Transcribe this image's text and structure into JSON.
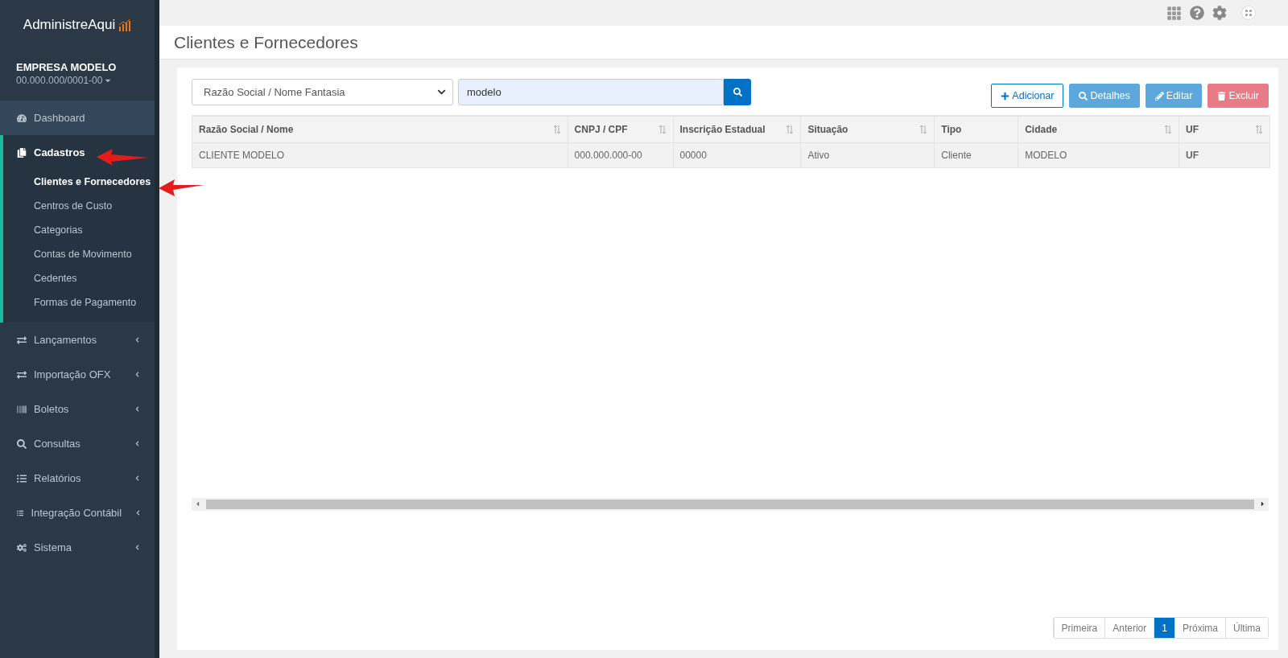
{
  "brand": {
    "name": "AdministreAqui"
  },
  "company": {
    "name": "EMPRESA MODELO",
    "document": "00.000.000/0001-00"
  },
  "sidebar": {
    "items": [
      {
        "label": "Dashboard",
        "selected": false,
        "has_submenu": false
      },
      {
        "label": "Cadastros",
        "selected": true,
        "has_submenu": false,
        "children": [
          {
            "label": "Clientes e Fornecedores",
            "selected": true
          },
          {
            "label": "Centros de Custo",
            "selected": false
          },
          {
            "label": "Categorias",
            "selected": false
          },
          {
            "label": "Contas de Movimento",
            "selected": false
          },
          {
            "label": "Cedentes",
            "selected": false
          },
          {
            "label": "Formas de Pagamento",
            "selected": false
          }
        ]
      },
      {
        "label": "Lançamentos",
        "selected": false,
        "has_submenu": true
      },
      {
        "label": "Importação OFX",
        "selected": false,
        "has_submenu": true
      },
      {
        "label": "Boletos",
        "selected": false,
        "has_submenu": true
      },
      {
        "label": "Consultas",
        "selected": false,
        "has_submenu": true
      },
      {
        "label": "Relatórios",
        "selected": false,
        "has_submenu": true
      },
      {
        "label": "Integração Contábil",
        "selected": false,
        "has_submenu": true
      },
      {
        "label": "Sistema",
        "selected": false,
        "has_submenu": true
      }
    ]
  },
  "page": {
    "title": "Clientes e Fornecedores"
  },
  "filter": {
    "field": "Razão Social / Nome Fantasia",
    "query": "modelo"
  },
  "buttons": [
    {
      "label": "Adicionar",
      "kind": "outline"
    },
    {
      "label": "Detalhes",
      "kind": "info"
    },
    {
      "label": "Editar",
      "kind": "info"
    },
    {
      "label": "Excluir",
      "kind": "danger"
    }
  ],
  "table": {
    "columns": [
      {
        "label": "Razão Social / Nome",
        "sortable": true,
        "bold_cells": false
      },
      {
        "label": "CNPJ / CPF",
        "sortable": true,
        "bold_cells": false
      },
      {
        "label": "Inscrição Estadual",
        "sortable": true,
        "bold_cells": false
      },
      {
        "label": "Situação",
        "sortable": true,
        "bold_cells": false
      },
      {
        "label": "Tipo",
        "sortable": false,
        "bold_cells": false
      },
      {
        "label": "Cidade",
        "sortable": true,
        "bold_cells": false
      },
      {
        "label": "UF",
        "sortable": true,
        "bold_cells": true
      }
    ],
    "rows": [
      [
        "CLIENTE MODELO",
        "000.000.000-00",
        "00000",
        "Ativo",
        "Cliente",
        "MODELO",
        "UF"
      ]
    ]
  },
  "pagination": [
    {
      "label": "Primeira",
      "selected": false
    },
    {
      "label": "Anterior",
      "selected": false
    },
    {
      "label": "1",
      "selected": true
    },
    {
      "label": "Próxima",
      "selected": false
    },
    {
      "label": "Última",
      "selected": false
    }
  ]
}
